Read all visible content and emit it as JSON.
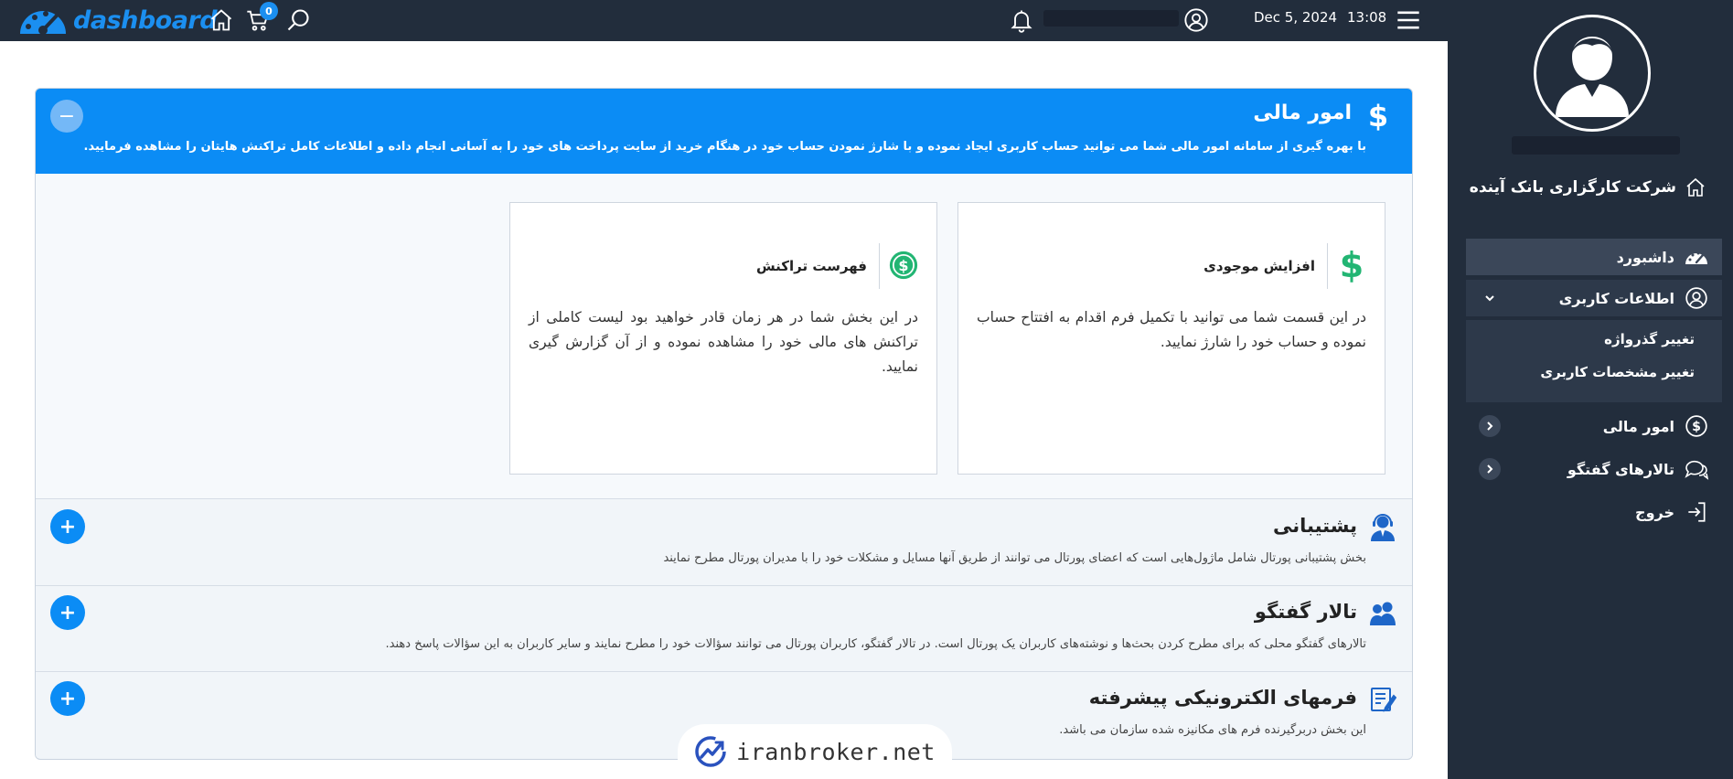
{
  "topbar": {
    "brand": "dashboard",
    "cart_count": "0",
    "date": "Dec 5, 2024",
    "time": "13:08"
  },
  "sidebar": {
    "company": "شرکت کارگزاری بانک آینده",
    "nav": {
      "dashboard": "داشبورد",
      "user_info": "اطلاعات کاربری",
      "change_password": "تغییر گذرواژه",
      "change_profile": "تغییر مشخصات کاربری",
      "finance": "امور مالی",
      "forums": "تالارهای گفتگو",
      "logout": "خروج"
    }
  },
  "finance_panel": {
    "title": "امور مالی",
    "description": "با بهره گیری از سامانه امور مالی شما می توانید حساب کاربری ایجاد نموده و با شارژ نمودن حساب خود در هنگام خرید از سایت پرداخت های خود را به آسانی انجام داده و اطلاعات کامل تراکنش هایتان را مشاهده فرمایید.",
    "collapse_symbol": "−",
    "cards": [
      {
        "title": "افزایش موجودی",
        "description": "در این قسمت شما می توانید با تکمیل فرم اقدام به افتتاح حساب نموده و حساب خود را شارژ نمایید."
      },
      {
        "title": "فهرست تراکنش",
        "description": "در این بخش شما در هر زمان قادر خواهید بود لیست کاملی از تراکنش های مالی خود را مشاهده نموده و از آن گزارش گیری نمایید."
      }
    ]
  },
  "sections": [
    {
      "title": "پشتیبانی",
      "description": "بخش پشتیبانی پورتال شامل ماژول‌هایی است که اعضای پورتال می توانند از طریق آنها مسایل و مشکلات خود را با مدیران پورتال مطرح نمایند",
      "expand_symbol": "+"
    },
    {
      "title": "تالار گفتگو",
      "description": "تالارهای گفتگو محلی که برای مطرح کردن بحث‌ها و نوشته‌های کاربران یک پورتال است. در تالار گفتگو، کاربران پورتال می توانند سؤالات خود را مطرح نمایند و سایر کاربران به این سؤالات پاسخ دهند.",
      "expand_symbol": "+"
    },
    {
      "title": "فرمهای الکترونیکی پیشرفته",
      "description": "این بخش دربرگیرنده فرم های مکانیزه شده سازمان می باشد.",
      "expand_symbol": "+"
    }
  ],
  "watermark": "iranbroker.net",
  "colors": {
    "topbar": "#222d3c",
    "primary": "#0b8cf5",
    "green": "#22b573",
    "sidebar_active": "#3b4759"
  }
}
